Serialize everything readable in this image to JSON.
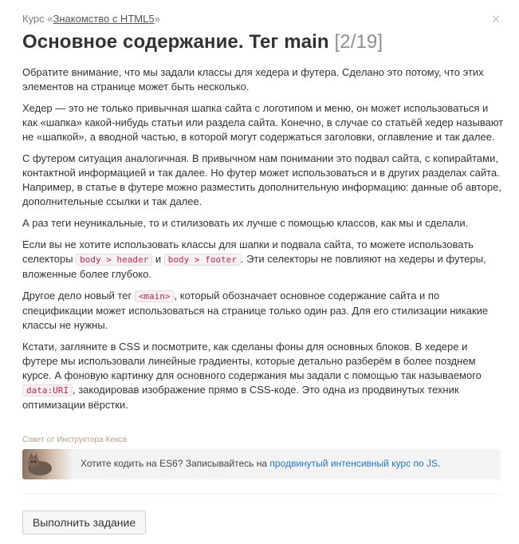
{
  "header": {
    "course_prefix": "Курс «",
    "course_name": "Знакомство с HTML5",
    "course_suffix": "»",
    "close_glyph": "×",
    "title": "Основное содержание. Тег main",
    "counter": "[2/19]"
  },
  "content": {
    "p1": "Обратите внимание, что мы задали классы для хедера и футера. Сделано это потому, что этих элементов на странице может быть несколько.",
    "p2": "Хедер — это не только привычная шапка сайта с логотипом и меню, он может использоваться и как «шапка» какой-нибудь статьи или раздела сайта. Конечно, в случае со статьёй хедер называют не «шапкой», а вводной частью, в которой могут содержаться заголовки, оглавление и так далее.",
    "p3": "С футером ситуация аналогичная. В привычном нам понимании это подвал сайта, с копирайтами, контактной информацией и так далее. Но футер может использоваться и в других разделах сайта. Например, в статье в футере можно разместить дополнительную информацию: данные об авторе, дополнительные ссылки и так далее.",
    "p4": "А раз теги неуникальные, то и стилизовать их лучше с помощью классов, как мы и сделали.",
    "p5_a": "Если вы не хотите использовать классы для шапки и подвала сайта, то можете использовать селекторы ",
    "p5_code1": "body > header",
    "p5_b": " и ",
    "p5_code2": "body > footer",
    "p5_c": ". Эти селекторы не повлияют на хедеры и футеры, вложенные более глубоко.",
    "p6_a": "Другое дело новый тег ",
    "p6_code": "<main>",
    "p6_b": ", который обозначает основное содержание сайта и по спецификации может использоваться на странице только один раз. Для его стилизации никакие классы не нужны.",
    "p7_a": "Кстати, загляните в CSS и посмотрите, как сделаны фоны для основных блоков. В хедере и футере мы использовали линейные градиенты, которые детально разберём в более позднем курсе. А фоновую картинку для основного содержания мы задали с помощью так называемого ",
    "p7_code": "data:URI",
    "p7_b": ", закодировав изображение прямо в CSS-коде. Это одна из продвинутых техник оптимизации вёрстки."
  },
  "tip": {
    "label": "Совет от Инструктора Кекса",
    "text": "Хотите кодить на ES6? Записывайтесь на ",
    "link": "продвинутый интенсивный курс по JS",
    "text_end": "."
  },
  "actions": {
    "submit_label": "Выполнить задание"
  }
}
